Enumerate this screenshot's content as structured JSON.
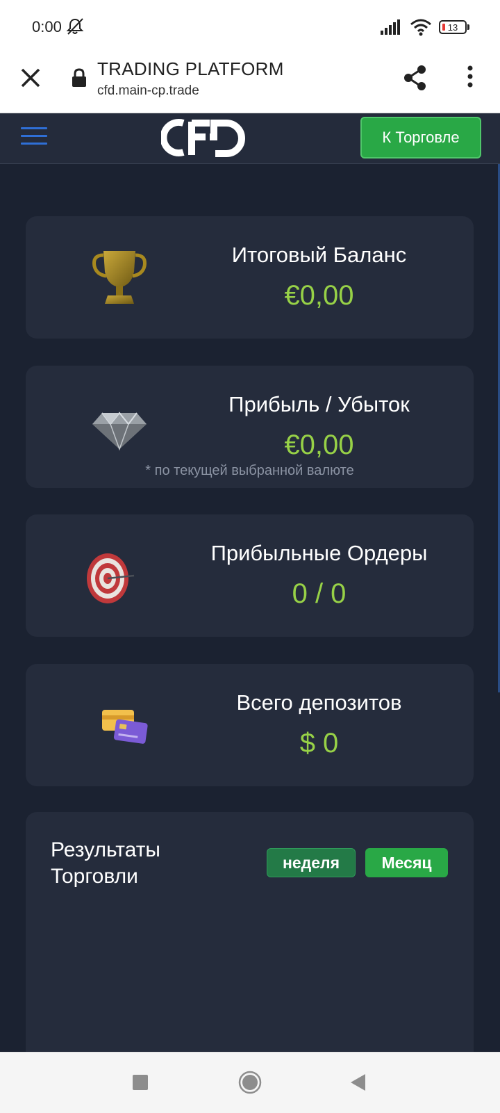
{
  "status_bar": {
    "time": "0:00",
    "battery_level": "13"
  },
  "browser": {
    "title": "TRADING PLATFORM",
    "url": "cfd.main-cp.trade"
  },
  "header": {
    "logo_text": "CFD",
    "trade_button_label": "К Торговле"
  },
  "cards": [
    {
      "title": "Итоговый Баланс",
      "value": "€0,00",
      "icon": "trophy-icon"
    },
    {
      "title": "Прибыль / Убыток",
      "value": "€0,00",
      "note": "* по текущей выбранной валюте",
      "icon": "diamond-icon"
    },
    {
      "title": "Прибыльные Ордеры",
      "value": "0 / 0",
      "icon": "target-icon"
    },
    {
      "title": "Всего депозитов",
      "value": "$ 0",
      "icon": "credit-cards-icon"
    }
  ],
  "results": {
    "title": "Результаты Торговли",
    "week_label": "неделя",
    "month_label": "Месяц"
  },
  "colors": {
    "background": "#1b2231",
    "card": "#252c3c",
    "value_green": "#97d147",
    "button_green": "#29a846",
    "accent_blue": "#2f6fd6"
  }
}
